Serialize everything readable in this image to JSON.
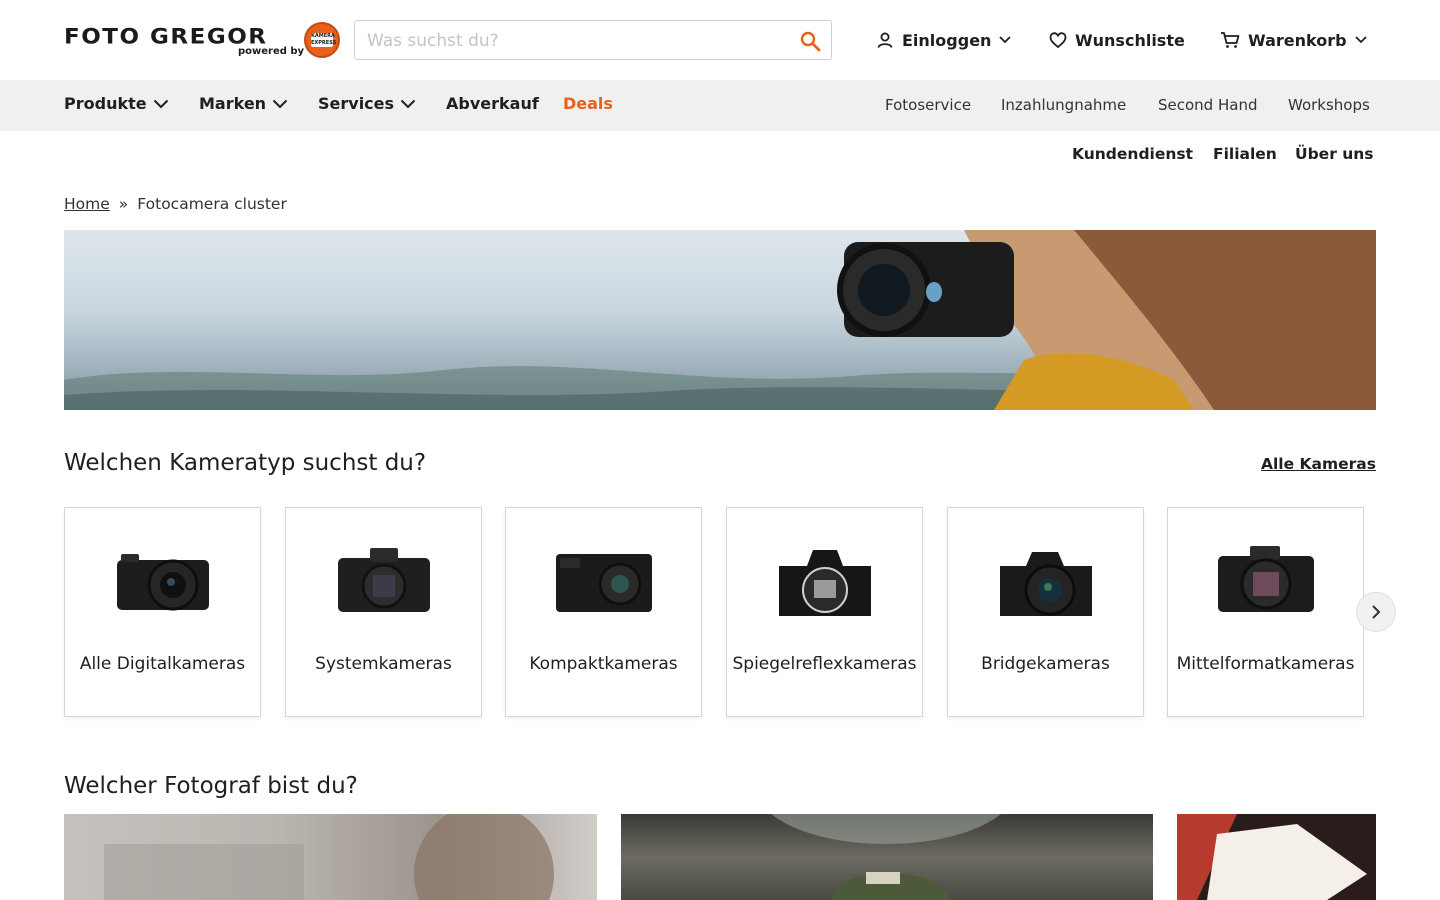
{
  "header": {
    "logo_text": "FOTO GREGOR",
    "logo_sub": "powered by",
    "logo_badge": "KAMERA EXPRESS",
    "search_placeholder": "Was suchst du?",
    "login_label": "Einloggen",
    "wishlist_label": "Wunschliste",
    "cart_label": "Warenkorb"
  },
  "nav": {
    "items": [
      {
        "label": "Produkte"
      },
      {
        "label": "Marken"
      },
      {
        "label": "Services"
      },
      {
        "label": "Abverkauf"
      },
      {
        "label": "Deals"
      }
    ],
    "right_links": [
      "Fotoservice",
      "Inzahlungnahme",
      "Second Hand",
      "Workshops"
    ],
    "sub_links": [
      "Kundendienst",
      "Filialen",
      "Über uns"
    ]
  },
  "breadcrumb": {
    "home": "Home",
    "separator": "»",
    "current": "Fotocamera cluster"
  },
  "camera_section": {
    "title": "Welchen Kameratyp suchst du?",
    "all_link": "Alle Kameras",
    "cards": [
      {
        "label": "Alle Digitalkameras"
      },
      {
        "label": "Systemkameras"
      },
      {
        "label": "Kompaktkameras"
      },
      {
        "label": "Spiegelreflexkameras"
      },
      {
        "label": "Bridgekameras"
      },
      {
        "label": "Mittelformatkameras"
      }
    ]
  },
  "photographer_section": {
    "title": "Welcher Fotograf bist du?"
  },
  "colors": {
    "accent": "#e8601c",
    "nav_bg": "#f0f0f0",
    "text": "#1f1f1f"
  }
}
